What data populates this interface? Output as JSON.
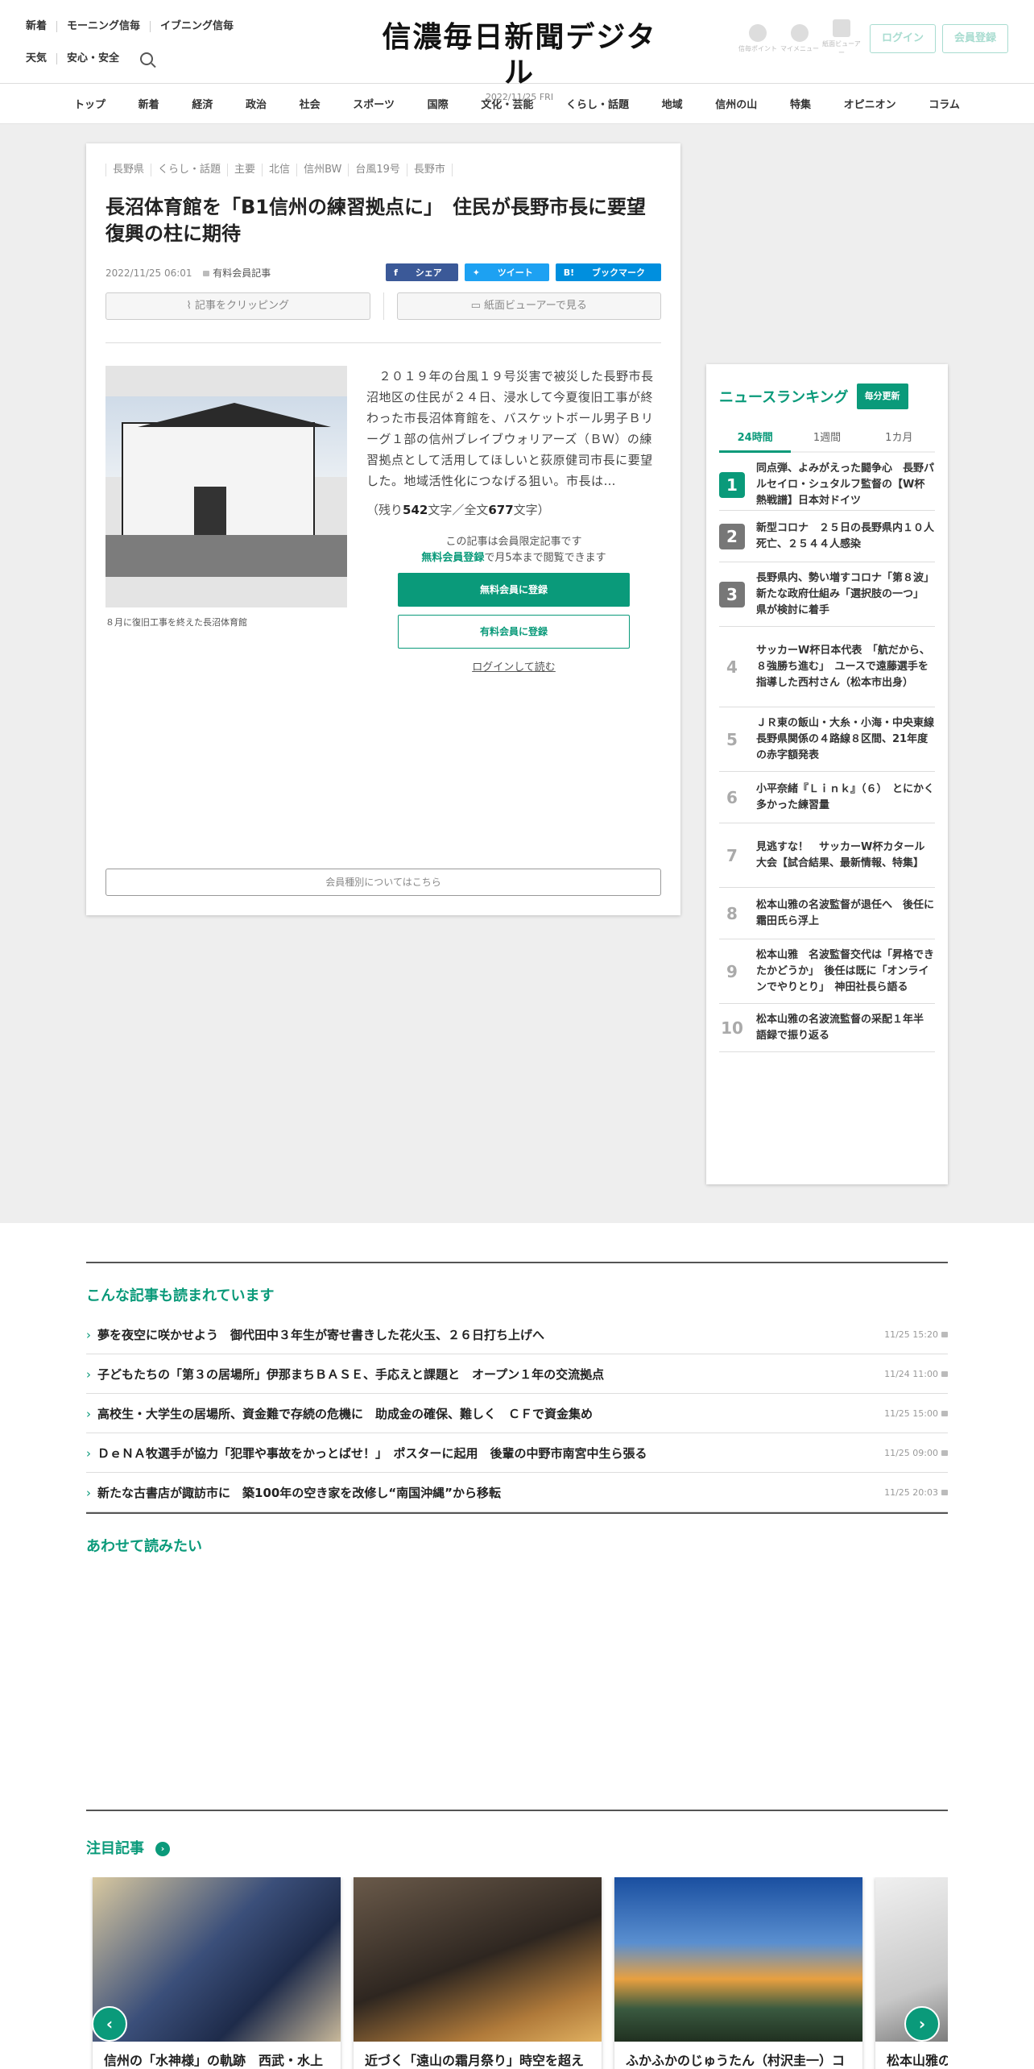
{
  "header": {
    "links_row1": [
      "新着",
      "モーニング信毎",
      "イブニング信毎"
    ],
    "links_row2": [
      "天気",
      "安心・安全"
    ],
    "logo": "信濃毎日新聞デジタル",
    "date": "2022/11/25",
    "weekday": "FRI",
    "icons": [
      "信毎ポイント",
      "マイメニュー",
      "紙面ビューアー"
    ],
    "login": "ログイン",
    "register": "会員登録"
  },
  "nav": [
    "トップ",
    "新着",
    "経済",
    "政治",
    "社会",
    "スポーツ",
    "国際",
    "文化・芸能",
    "くらし・話題",
    "地域",
    "信州の山",
    "特集",
    "オピニオン",
    "コラム"
  ],
  "article": {
    "tags": [
      "長野県",
      "くらし・話題",
      "主要",
      "北信",
      "信州BW",
      "台風19号",
      "長野市"
    ],
    "title_line1": "長沼体育館を「B1信州の練習拠点に」　住民が長野市長に要望",
    "title_line2": "復興の柱に期待",
    "datetime": "2022/11/25 06:01",
    "paid_label": "有料会員記事",
    "share": [
      "シェア",
      "ツイート",
      "ブックマーク"
    ],
    "clip": "記事をクリッピング",
    "viewer": "紙面ビューアーで見る",
    "caption": "８月に復旧工事を終えた長沼体育館",
    "lead": "　２０１９年の台風１９号災害で被災した長野市長沼地区の住民が２４日、浸水して今夏復旧工事が終わった市長沼体育館を、バスケットボール男子Ｂリーグ１部の信州ブレイブウォリアーズ（ＢＷ）の練習拠点として活用してほしいと荻原健司市長に要望した。地域活性化につなげる狙い。市長は…",
    "remain_prefix": "（残り",
    "remain": "542",
    "remain_mid": "文字／全文",
    "total": "677",
    "remain_suffix": "文字）",
    "member_note": "この記事は会員限定記事です",
    "free_reg": "無料会員登録",
    "free_reg_suffix": "で月5本まで閲覧できます",
    "btn_free": "無料会員に登録",
    "btn_paid": "有料会員に登録",
    "login_read": "ログインして読む",
    "plans": "会員種別についてはこちら"
  },
  "ranking": {
    "title": "ニュースランキング",
    "badge": "毎分更新",
    "tabs": [
      "24時間",
      "1週間",
      "1カ月"
    ],
    "items": [
      {
        "n": "1",
        "t": "同点弾、よみがえった闘争心　長野パルセイロ・シュタルフ監督の【W杯熱戦譜】日本対ドイツ"
      },
      {
        "n": "2",
        "t": "新型コロナ　２５日の長野県内１０人死亡、２５４４人感染"
      },
      {
        "n": "3",
        "t": "長野県内、勢い増すコロナ「第８波」　新たな政府仕組み「選択肢の一つ」　県が検討に着手"
      },
      {
        "n": "4",
        "t": "サッカーW杯日本代表　「航だから、８強勝ち進む」　ユースで遠藤選手を指導した西村さん（松本市出身）"
      },
      {
        "n": "5",
        "t": "ＪＲ東の飯山・大糸・小海・中央東線　長野県関係の４路線８区間、21年度の赤字額発表"
      },
      {
        "n": "6",
        "t": "小平奈緒『Ｌｉｎｋ』（６）　とにかく多かった練習量"
      },
      {
        "n": "7",
        "t": "見逃すな！　サッカーW杯カタール大会【試合結果、最新情報、特集】"
      },
      {
        "n": "8",
        "t": "松本山雅の名波監督が退任へ　後任に霜田氏ら浮上"
      },
      {
        "n": "9",
        "t": "松本山雅　名波監督交代は「昇格できたかどうか」　後任は既に「オンラインでやりとり」　神田社長ら語る"
      },
      {
        "n": "10",
        "t": "松本山雅の名波流監督の采配１年半　語録で振り返る"
      }
    ]
  },
  "also_read": {
    "title": "こんな記事も読まれています",
    "items": [
      {
        "t": "夢を夜空に咲かせよう　御代田中３年生が寄せ書きした花火玉、２６日打ち上げへ",
        "time": "11/25 15:20"
      },
      {
        "t": "子どもたちの「第３の居場所」伊那まちＢＡＳＥ、手応えと課題と　オープン１年の交流拠点",
        "time": "11/24 11:00"
      },
      {
        "t": "高校生・大学生の居場所、資金難で存続の危機に　助成金の確保、難しく　ＣＦで資金集め",
        "time": "11/25 15:00"
      },
      {
        "t": "ＤｅＮＡ牧選手が協力「犯罪や事故をかっとばせ！」　ポスターに起用　後輩の中野市南宮中生ら張る",
        "time": "11/25 09:00"
      },
      {
        "t": "新たな古書店が諏訪市に　築100年の空き家を改修し“南国沖縄”から移転",
        "time": "11/25 20:03"
      }
    ]
  },
  "together": {
    "title": "あわせて読みたい"
  },
  "featured": {
    "title": "注目記事",
    "cards": [
      {
        "t": "信州の「水神様」の軌跡　西武・水上"
      },
      {
        "t": "近づく「遠山の霜月祭り」時空を超え"
      },
      {
        "t": "ふかふかのじゅうたん（村沢圭一）コ"
      },
      {
        "t": "松本山雅の"
      }
    ]
  },
  "colors": {
    "accent": "#0a9a7a"
  }
}
